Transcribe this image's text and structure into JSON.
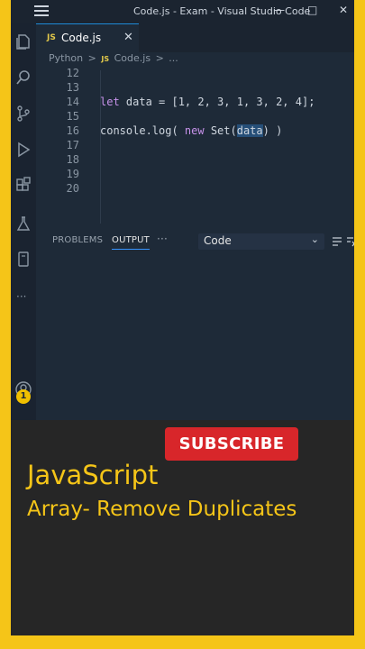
{
  "window": {
    "title": "Code.js - Exam - Visual Studio Code",
    "controls": [
      "—",
      "□",
      "✕"
    ]
  },
  "tab": {
    "lang_badge": "JS",
    "filename": "Code.js",
    "close_icon": "close-icon"
  },
  "breadcrumb": {
    "items": [
      "Python",
      ">",
      "JS",
      "Code.js",
      ">",
      "..."
    ]
  },
  "code": {
    "lines": [
      {
        "num": "12",
        "text": ""
      },
      {
        "num": "13",
        "text": ""
      },
      {
        "num": "14",
        "text": "let data = [1, 2, 3, 1, 3, 2, 4];"
      },
      {
        "num": "15",
        "text": ""
      },
      {
        "num": "16",
        "text": "console.log( new Set(data) )"
      },
      {
        "num": "17",
        "text": ""
      },
      {
        "num": "18",
        "text": ""
      },
      {
        "num": "19",
        "text": ""
      },
      {
        "num": "20",
        "text": ""
      }
    ],
    "line14": {
      "kw": "let",
      "rest": " data = [1, 2, 3, 1, 3, 2, 4];"
    },
    "line16": {
      "a": "console.log( ",
      "kw": "new",
      "b": " Set(",
      "sel": "data",
      "c": ") )"
    }
  },
  "panel": {
    "tabs": [
      "PROBLEMS",
      "OUTPUT",
      "···"
    ],
    "active_tab": "OUTPUT",
    "dropdown_value": "Code",
    "icons": [
      "filter-lines-icon",
      "clear-output-icon",
      "lock-icon"
    ]
  },
  "activity": {
    "badge_count": "1"
  },
  "overlay": {
    "subscribe": "SUBSCRIBE",
    "headline1": "JavaScript",
    "headline2": "Array- Remove Duplicates"
  },
  "colors": {
    "frame": "#f5c518",
    "editor_bg": "#1e2a38",
    "subscribe_bg": "#d8262a",
    "accent": "#3794ff"
  }
}
